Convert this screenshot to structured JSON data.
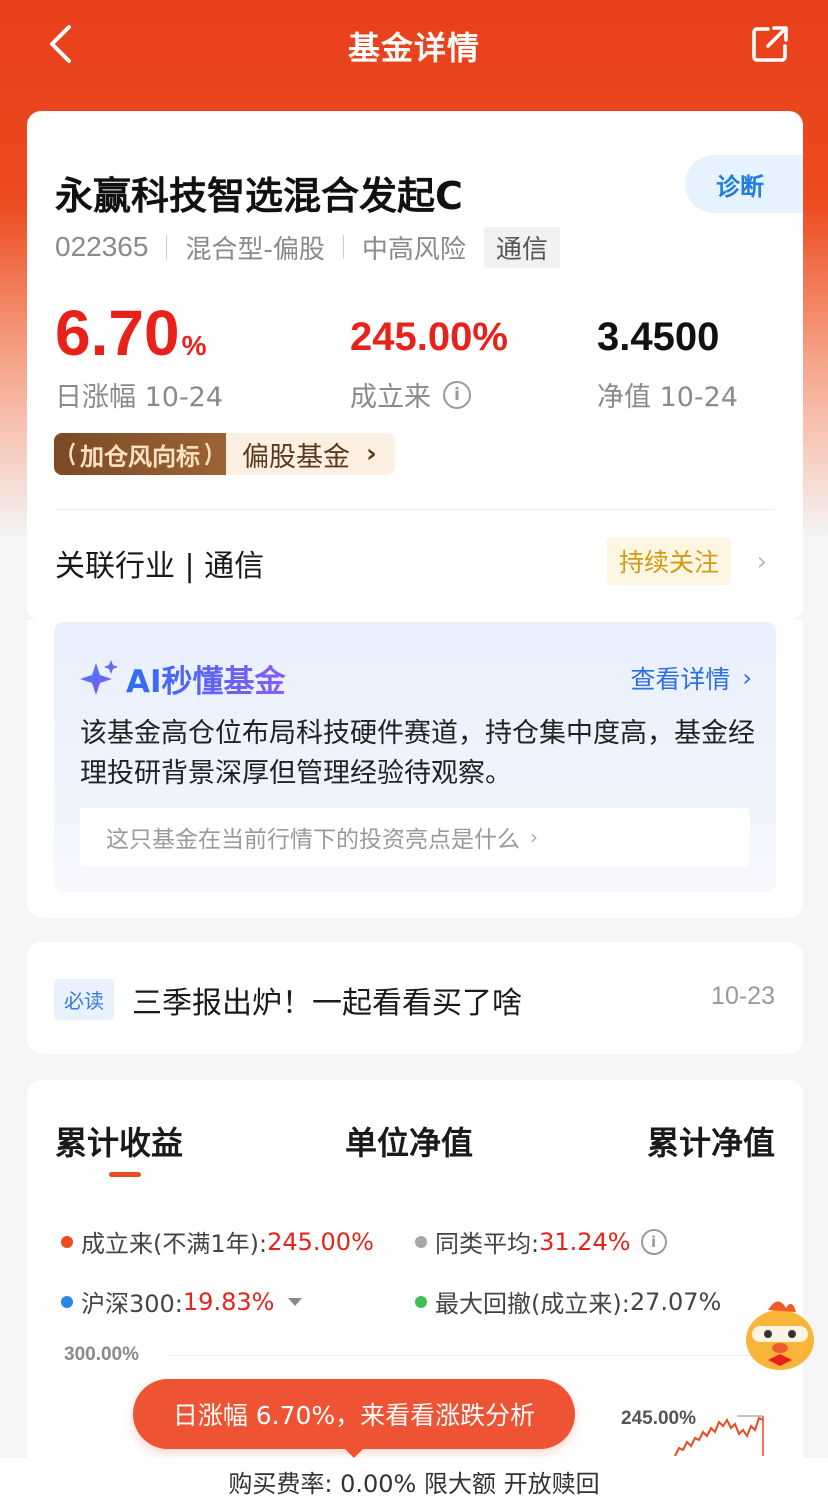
{
  "header": {
    "title": "基金详情"
  },
  "fund": {
    "name": "永赢科技智选混合发起C",
    "diagnose_label": "诊断",
    "code": "022365",
    "type": "混合型-偏股",
    "risk": "中高风险",
    "tag": "通信"
  },
  "stats": {
    "daily_change_value": "6.70",
    "daily_change_unit": "%",
    "daily_change_label": "日涨幅 10-24",
    "since_inception_value": "245.00%",
    "since_inception_label": "成立来",
    "nav_value": "3.4500",
    "nav_label": "净值 10-24"
  },
  "banner": {
    "left_label": "加仓风向标",
    "right_label": "偏股基金"
  },
  "industry": {
    "label": "关联行业 | 通信",
    "follow_label": "持续关注"
  },
  "ai": {
    "title": "AI秒懂基金",
    "detail_label": "查看详情",
    "summary": "该基金高仓位布局科技硬件赛道，持仓集中度高，基金经理投研背景深厚但管理经验待观察。",
    "question": "这只基金在当前行情下的投资亮点是什么"
  },
  "news": {
    "badge": "必读",
    "title": "三季报出炉！一起看看买了啥",
    "date": "10-23"
  },
  "performance": {
    "tabs": [
      "累计收益",
      "单位净值",
      "累计净值"
    ],
    "legend": {
      "inception_label": "成立来(不满1年): ",
      "inception_value": "245.00%",
      "peer_label": "同类平均: ",
      "peer_value": "31.24%",
      "index_label": "沪深300: ",
      "index_value": "19.83%",
      "drawdown_label": "最大回撤(成立来): ",
      "drawdown_value": "27.07%"
    },
    "y_tick": "300.00%",
    "chart_end_label": "245.00%"
  },
  "pill": {
    "label": "日涨幅 6.70%，来看看涨跌分析"
  },
  "bottom": {
    "label": "购买费率: 0.00%  限大额  开放赎回"
  },
  "colors": {
    "brand": "#ec4a1f",
    "up": "#e8221b",
    "ai_blue": "#2d6ee6"
  }
}
